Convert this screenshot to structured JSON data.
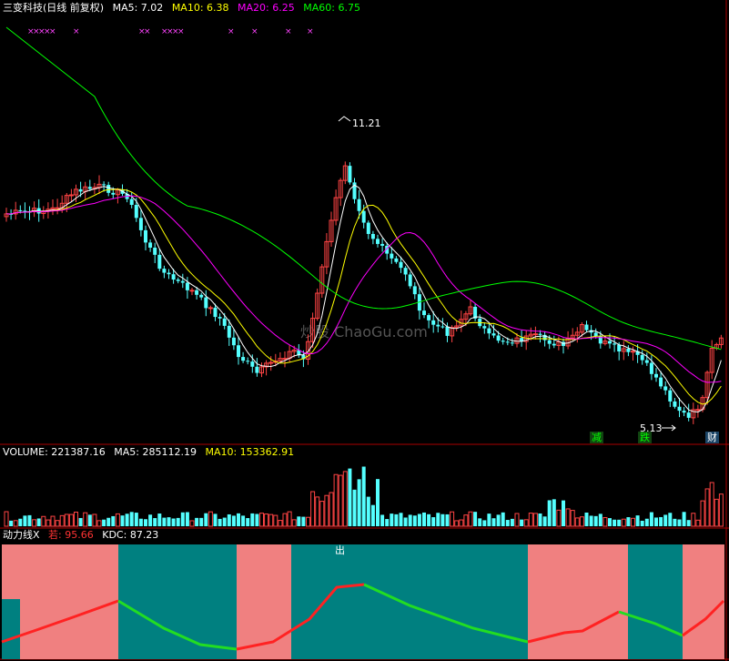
{
  "price_panel": {
    "title": "三变科技(日线 前复权)",
    "ma": [
      {
        "label": "MA5: 7.02",
        "color": "#ffffff"
      },
      {
        "label": "MA10: 6.38",
        "color": "#ffff00"
      },
      {
        "label": "MA20: 6.25",
        "color": "#ff00ff"
      },
      {
        "label": "MA60: 6.75",
        "color": "#00ff00"
      }
    ],
    "high_label": "11.21",
    "low_label": "5.13",
    "signals": [
      {
        "text": "减",
        "color": "#00ff00",
        "bg": "#114411"
      },
      {
        "text": "跌",
        "color": "#00ff00",
        "bg": "#114411"
      },
      {
        "text": "财",
        "color": "#ffffff",
        "bg": "#1a4466"
      }
    ],
    "watermark": "炒股 ChaoGu.com"
  },
  "volume_panel": {
    "items": [
      {
        "label": "VOLUME: 221387.16",
        "color": "#ffffff"
      },
      {
        "label": "MA5: 285112.19",
        "color": "#ffffff"
      },
      {
        "label": "MA10: 153362.91",
        "color": "#ffff00"
      }
    ]
  },
  "indicator_panel": {
    "title": "动力线X",
    "ruo": "若: 95.66",
    "kdc": "KDC: 87.23",
    "out_label": "出",
    "colors": {
      "up": "#f08080",
      "down": "#008080"
    }
  },
  "chart_data": {
    "type": "candlestick",
    "price_extremes": {
      "high": 11.21,
      "low": 5.13
    },
    "moving_averages": {
      "MA5": 7.02,
      "MA10": 6.38,
      "MA20": 6.25,
      "MA60": 6.75
    },
    "volume": {
      "VOLUME": 221387.16,
      "MA5": 285112.19,
      "MA10": 153362.91
    },
    "indicator": {
      "name": "动力线X",
      "若": 95.66,
      "KDC": 87.23
    }
  }
}
